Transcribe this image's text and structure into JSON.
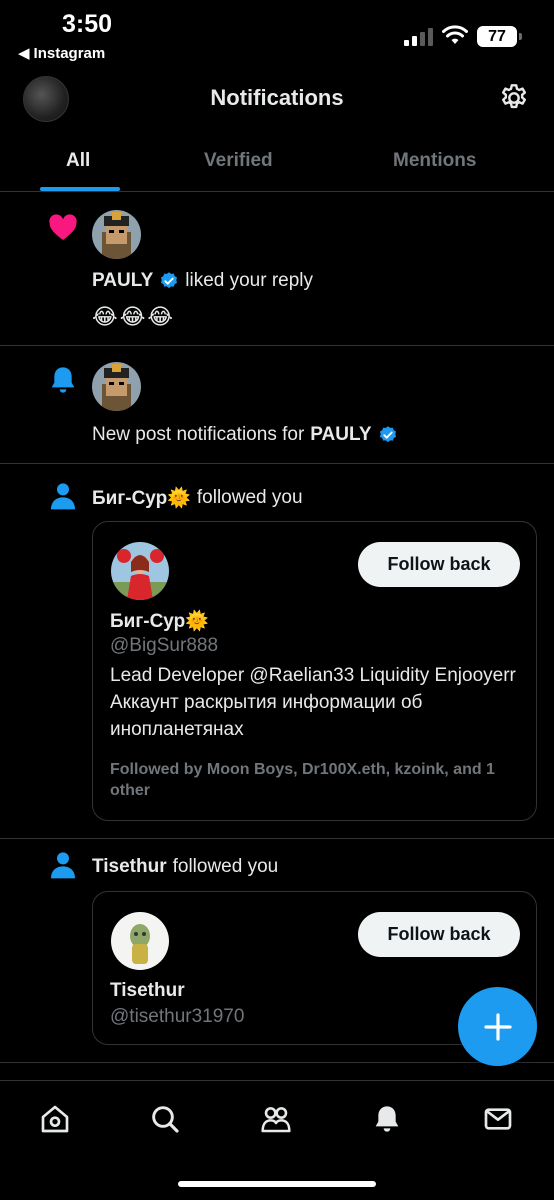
{
  "status_bar": {
    "time": "3:50",
    "back_app": "Instagram",
    "battery": "77"
  },
  "header": {
    "title": "Notifications"
  },
  "tabs": [
    {
      "label": "All",
      "active": true
    },
    {
      "label": "Verified",
      "active": false
    },
    {
      "label": "Mentions",
      "active": false
    }
  ],
  "notifications": [
    {
      "type": "like",
      "icon": "heart-icon",
      "user": "PAULY",
      "verified": true,
      "action": "liked your reply",
      "content": "😂😂😂"
    },
    {
      "type": "new_post",
      "icon": "bell-icon",
      "prefix": "New post notifications for",
      "user": "PAULY",
      "verified": true
    },
    {
      "type": "follow",
      "icon": "person-icon",
      "user": "Биг-Сур🌞",
      "action": "followed you",
      "card": {
        "name": "Биг-Сур🌞",
        "handle": "@BigSur888",
        "bio": "Lead Developer @Raelian33 Liquidity Enjooyerr Аккаунт раскрытия информации об инопланетянах",
        "followed_by": "Followed by Moon Boys, Dr100X.eth, kzoink, and 1 other",
        "button": "Follow back"
      }
    },
    {
      "type": "follow",
      "icon": "person-icon",
      "user": "Tisethur",
      "action": "followed you",
      "card": {
        "name": "Tisethur",
        "handle": "@tisethur31970",
        "button": "Follow back"
      }
    }
  ],
  "bottom_nav": [
    "home-icon",
    "search-icon",
    "communities-icon",
    "notifications-icon",
    "messages-icon"
  ],
  "colors": {
    "accent": "#1d9bf0",
    "like": "#f91880",
    "background": "#000000"
  }
}
